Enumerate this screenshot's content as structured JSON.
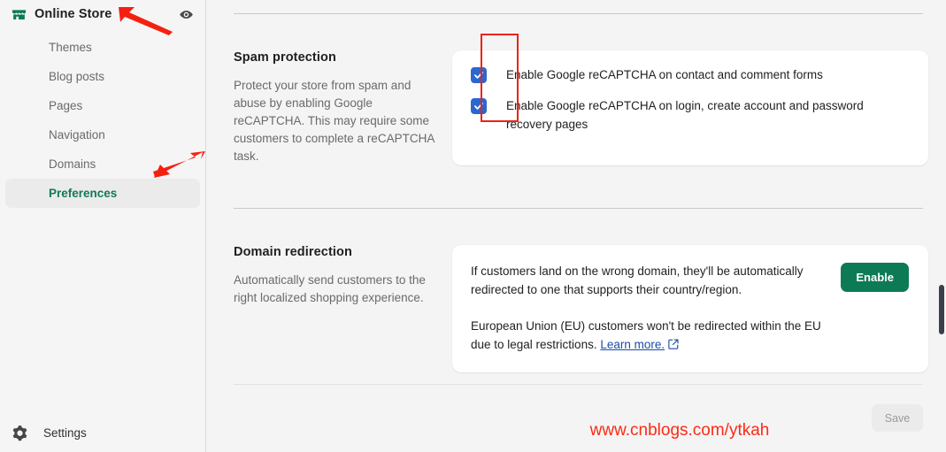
{
  "sidebar": {
    "store": {
      "icon": "storefront-icon",
      "title": "Online Store",
      "preview_icon": "eye-icon"
    },
    "items": [
      {
        "label": "Themes",
        "selected": false
      },
      {
        "label": "Blog posts",
        "selected": false
      },
      {
        "label": "Pages",
        "selected": false
      },
      {
        "label": "Navigation",
        "selected": false
      },
      {
        "label": "Domains",
        "selected": false
      },
      {
        "label": "Preferences",
        "selected": true
      }
    ],
    "settings": {
      "icon": "gear-icon",
      "label": "Settings"
    }
  },
  "main": {
    "spam_protection": {
      "title": "Spam protection",
      "description": "Protect your store from spam and abuse by enabling Google reCAPTCHA. This may require some customers to complete a reCAPTCHA task.",
      "checkboxes": [
        {
          "label": "Enable Google reCAPTCHA on contact and comment forms",
          "checked": true
        },
        {
          "label": "Enable Google reCAPTCHA on login, create account and password recovery pages",
          "checked": true
        }
      ]
    },
    "domain_redirection": {
      "title": "Domain redirection",
      "description": "Automatically send customers to the right localized shopping experience.",
      "paragraph_1": "If customers land on the wrong domain, they'll be automatically redirected to one that supports their country/region.",
      "paragraph_2_before_link": "European Union (EU) customers won't be redirected within the EU due to legal restrictions. ",
      "learn_more_label": "Learn more.",
      "external_link_icon": "external-link-icon",
      "enable_button_label": "Enable"
    },
    "save_button_label": "Save",
    "watermark": "www.cnblogs.com/ytkah"
  },
  "annotations": {
    "checkbox_highlight": "red-rectangle-annotation",
    "arrow_online_store": "red-arrow-annotation",
    "arrow_preferences": "red-arrow-annotation"
  },
  "colors": {
    "accent_green": "#0d7a56",
    "selected_text_green": "#12795b",
    "checkbox_blue": "#2b66d1",
    "annotation_red": "#ee2211",
    "watermark_red": "#fb2b16",
    "link_blue": "#1b4ca8"
  }
}
